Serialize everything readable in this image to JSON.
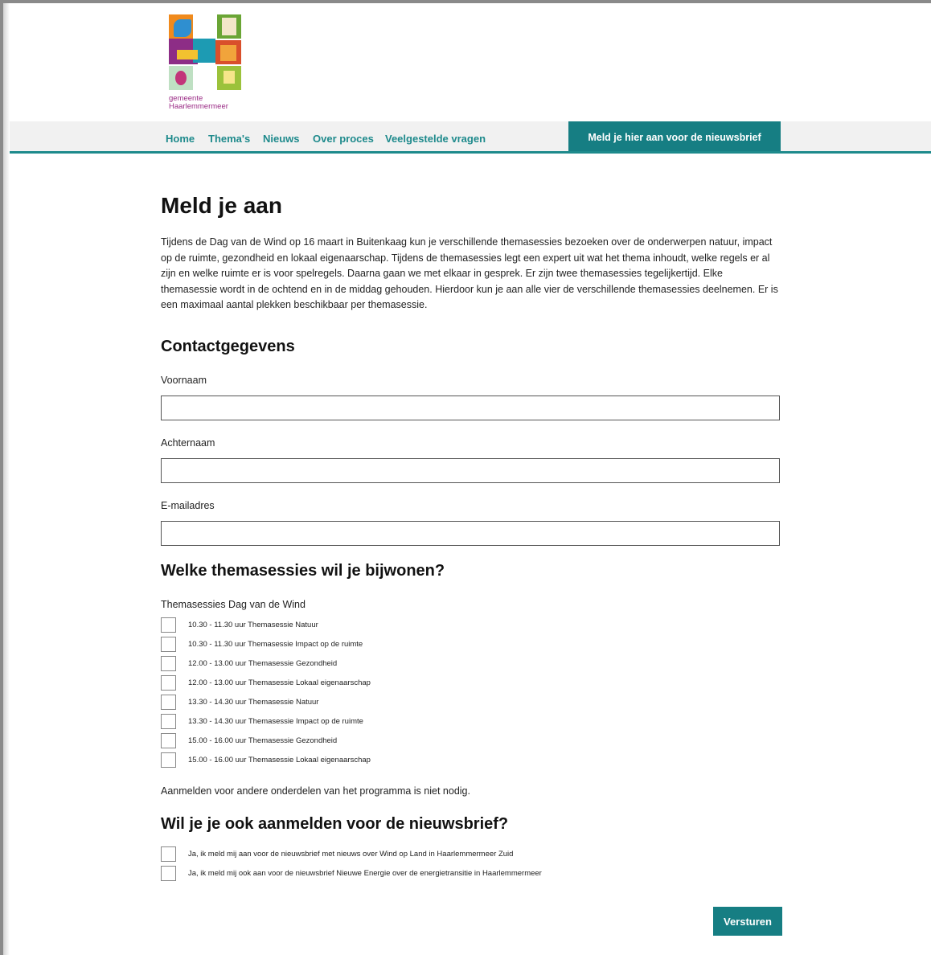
{
  "colors": {
    "accent": "#167e83",
    "nav_text": "#1e8a8c",
    "nav_background": "#f1f1f1",
    "logo_text": "#9b2c86"
  },
  "logo": {
    "line1": "gemeente",
    "line2": "Haarlemmermeer"
  },
  "nav": {
    "items": [
      {
        "label": "Home"
      },
      {
        "label": "Thema's"
      },
      {
        "label": "Nieuws"
      },
      {
        "label": "Over proces"
      },
      {
        "label": "Veelgestelde vragen"
      }
    ],
    "cta_label": "Meld je hier aan voor de nieuwsbrief"
  },
  "page": {
    "title": "Meld je aan",
    "intro": "Tijdens de Dag van de Wind op 16 maart in Buitenkaag kun je verschillende themasessies bezoeken over de onderwerpen natuur, impact op de ruimte, gezondheid en lokaal eigenaarschap. Tijdens de themasessies legt een expert uit wat het thema inhoudt, welke regels er al zijn en welke ruimte er is voor spelregels. Daarna gaan we met elkaar in gesprek. Er zijn twee themasessies tegelijkertijd. Elke themasessie wordt in de ochtend en in de middag gehouden. Hierdoor kun je aan alle vier de verschillende themasessies deelnemen. Er is een maximaal aantal plekken beschikbaar per themasessie."
  },
  "contact": {
    "heading": "Contactgegevens",
    "first_name_label": "Voornaam",
    "first_name_value": "",
    "last_name_label": "Achternaam",
    "last_name_value": "",
    "email_label": "E-mailadres",
    "email_value": ""
  },
  "sessions": {
    "heading": "Welke themasessies wil je bijwonen?",
    "group_label": "Themasessies Dag van de Wind",
    "options": [
      {
        "label": "10.30 - 11.30 uur Themasessie Natuur",
        "checked": false
      },
      {
        "label": "10.30 - 11.30 uur Themasessie Impact op de ruimte",
        "checked": false
      },
      {
        "label": "12.00 - 13.00 uur Themasessie Gezondheid",
        "checked": false
      },
      {
        "label": "12.00 - 13.00 uur Themasessie Lokaal eigenaarschap",
        "checked": false
      },
      {
        "label": "13.30 - 14.30 uur Themasessie Natuur",
        "checked": false
      },
      {
        "label": "13.30 - 14.30 uur Themasessie Impact op de ruimte",
        "checked": false
      },
      {
        "label": "15.00 - 16.00 uur Themasessie Gezondheid",
        "checked": false
      },
      {
        "label": "15.00 - 16.00 uur Themasessie Lokaal eigenaarschap",
        "checked": false
      }
    ],
    "note": "Aanmelden voor andere onderdelen van het programma is niet nodig."
  },
  "newsletter": {
    "heading": "Wil je je ook aanmelden voor de nieuwsbrief?",
    "options": [
      {
        "label": "Ja, ik meld mij aan voor de nieuwsbrief met nieuws over Wind op Land in Haarlemmermeer Zuid",
        "checked": false
      },
      {
        "label": "Ja, ik meld mij ook aan voor de nieuwsbrief Nieuwe Energie over de energietransitie in Haarlemmermeer",
        "checked": false
      }
    ]
  },
  "submit_label": "Versturen"
}
